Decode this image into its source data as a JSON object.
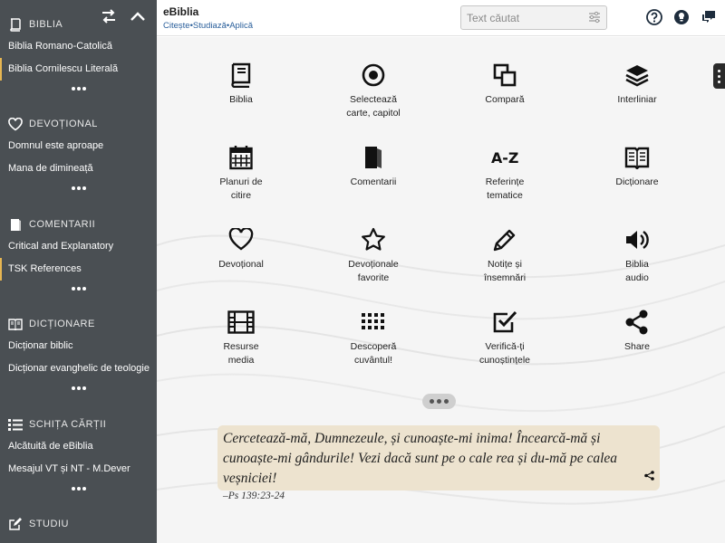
{
  "app": {
    "title": "eBiblia",
    "subtitle": "Citește•Studiază•Aplică"
  },
  "search": {
    "placeholder": "Text căutat",
    "value": ""
  },
  "sidebar": {
    "sections": [
      {
        "title": "Biblia",
        "icon": "book-icon",
        "items": [
          "Biblia Romano-Catolică",
          "Biblia Cornilescu Literală"
        ],
        "active_index": 1
      },
      {
        "title": "Devoțional",
        "icon": "heart-icon",
        "items": [
          "Domnul este aproape",
          "Mana de dimineață"
        ]
      },
      {
        "title": "Comentarii",
        "icon": "comment-book-icon",
        "items": [
          "Critical and Explanatory",
          "TSK References"
        ],
        "active_index": 1
      },
      {
        "title": "Dicționare",
        "icon": "dictionary-icon",
        "items": [
          "Dicționar biblic",
          "Dicționar evanghelic de teologie"
        ]
      },
      {
        "title": "Schița cărții",
        "icon": "outline-icon",
        "items": [
          "Alcătuită de eBiblia",
          "Mesajul VT și NT - M.Dever"
        ]
      },
      {
        "title": "Studiu",
        "icon": "edit-icon",
        "items": []
      }
    ]
  },
  "grid": [
    {
      "label": "Biblia",
      "icon": "book-icon"
    },
    {
      "label": "Selectează\ncarte, capitol",
      "icon": "target-icon"
    },
    {
      "label": "Compară",
      "icon": "compare-icon"
    },
    {
      "label": "Interliniar",
      "icon": "layers-icon"
    },
    {
      "label": "Planuri de\ncitire",
      "icon": "calendar-icon"
    },
    {
      "label": "Comentarii",
      "icon": "comment-book-icon"
    },
    {
      "label": "Referințe\ntematice",
      "icon": "a-z-icon"
    },
    {
      "label": "Dicționare",
      "icon": "dictionary-icon"
    },
    {
      "label": "Devoțional",
      "icon": "heart-icon"
    },
    {
      "label": "Devoționale\nfavorite",
      "icon": "star-icon"
    },
    {
      "label": "Notițe și\nînsemnări",
      "icon": "pencil-icon"
    },
    {
      "label": "Biblia\naudio",
      "icon": "speaker-icon"
    },
    {
      "label": "Resurse\nmedia",
      "icon": "film-icon"
    },
    {
      "label": "Descoperă\ncuvântul!",
      "icon": "grid-icon"
    },
    {
      "label": "Verifică-ți\ncunoștințele",
      "icon": "checkbox-icon"
    },
    {
      "label": "Share",
      "icon": "share-icon"
    }
  ],
  "verse": {
    "text": "Cercetează-mă, Dumnezeule, și cunoaște-mi inima! Încearcă-mă și cunoaște-mi gândurile! Vezi dacă sunt pe o cale rea și du-mă pe calea veșniciei!",
    "reference": "–Ps 139:23-24"
  },
  "colors": {
    "sidebar_bg": "#4a4f53",
    "accent": "#e7b652",
    "link": "#2a5f9b",
    "verse_bg": "#ede3cf"
  }
}
